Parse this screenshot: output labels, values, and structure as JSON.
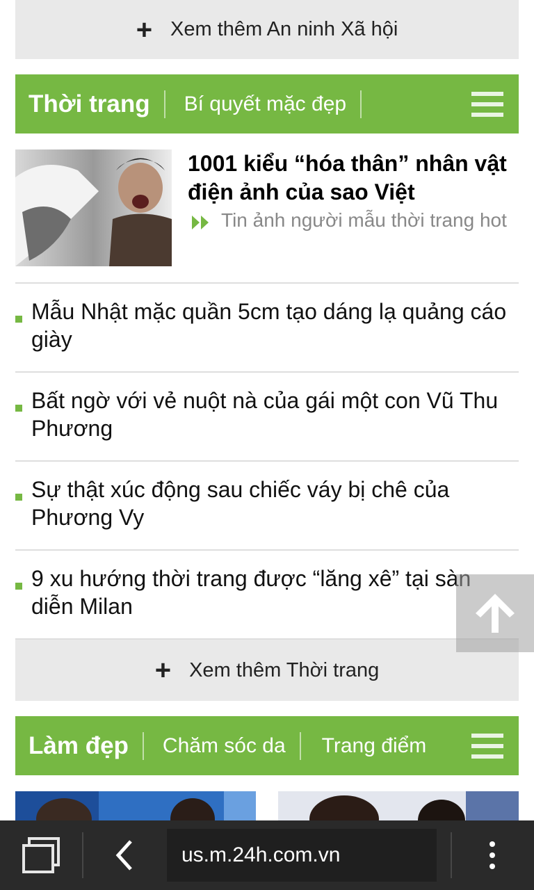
{
  "more_security": {
    "label": "Xem thêm An ninh Xã hội"
  },
  "fashion": {
    "category": "Thời trang",
    "subcategory": "Bí quyết mặc đẹp",
    "featured": {
      "title": "1001 kiểu “hóa thân” nhân vật điện ảnh của sao Việt",
      "sub_link": "Tin ảnh người mẫu thời trang hot"
    },
    "items": [
      "Mẫu Nhật mặc quần 5cm tạo dáng lạ quảng cáo giày",
      "Bất ngờ với vẻ nuột nà của gái một con Vũ Thu Phương",
      "Sự thật xúc động sau chiếc váy bị chê của Phương Vy",
      "9 xu hướng thời trang được “lăng xê” tại sàn diễn Milan"
    ],
    "more_label": "Xem thêm Thời trang"
  },
  "beauty": {
    "category": "Làm đẹp",
    "subcategories": [
      "Chăm sóc da",
      "Trang điểm"
    ]
  },
  "browser": {
    "url": "us.m.24h.com.vn"
  },
  "colors": {
    "accent": "#76b843",
    "more_bg": "#e9e9e9",
    "toolbar_bg": "#2a2a2a"
  },
  "icons": {
    "plus": "plus-icon",
    "menu": "hamburger-menu-icon",
    "arrow": "double-chevron-right-icon",
    "scroll_top": "arrow-up-icon",
    "tabs": "tabs-icon",
    "back": "chevron-left-icon",
    "overflow": "vertical-ellipsis-icon"
  }
}
